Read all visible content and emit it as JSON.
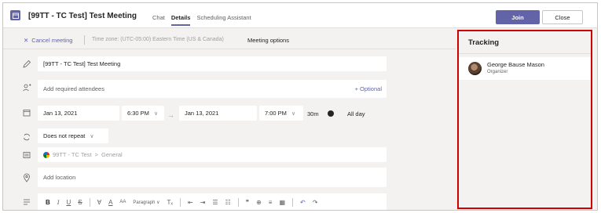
{
  "header": {
    "title": "[99TT - TC Test] Test Meeting",
    "tabs": [
      {
        "label": "Chat",
        "active": false
      },
      {
        "label": "Details",
        "active": true
      },
      {
        "label": "Scheduling Assistant",
        "active": false
      }
    ],
    "join_label": "Join",
    "close_label": "Close"
  },
  "subbar": {
    "cancel_label": "Cancel meeting",
    "timezone_label": "Time zone: (UTC-05:00) Eastern Time (US & Canada)",
    "meeting_options_label": "Meeting options"
  },
  "form": {
    "title_value": "[99TT - TC Test] Test Meeting",
    "attendees_placeholder": "Add required attendees",
    "optional_label": "+ Optional",
    "start_date": "Jan 13, 2021",
    "start_time": "6:30 PM",
    "end_date": "Jan 13, 2021",
    "end_time": "7:00 PM",
    "duration": "30m",
    "all_day_label": "All day",
    "repeat_value": "Does not repeat",
    "channel_team": "99TT - TC Test",
    "channel_separator": ">",
    "channel_name": "General",
    "location_placeholder": "Add location"
  },
  "format_toolbar": {
    "bold": "B",
    "italic": "I",
    "underline": "U",
    "strike": "S",
    "highlight": "∀",
    "font_color": "A",
    "font_size": "AA",
    "paragraph_label": "Paragraph ∨",
    "clear_format": "Tₓ",
    "outdent": "⇤",
    "indent": "⇥",
    "bullets": "☰",
    "numbered": "☷",
    "quote": "❞",
    "link": "⊕",
    "align": "≡",
    "table": "▦",
    "undo": "↶",
    "redo": "↷"
  },
  "tracking": {
    "title": "Tracking",
    "attendees": [
      {
        "name": "George Bause Mason",
        "role": "Organizer"
      }
    ]
  },
  "colors": {
    "accent": "#6264a7",
    "highlight_border": "#d10000"
  }
}
